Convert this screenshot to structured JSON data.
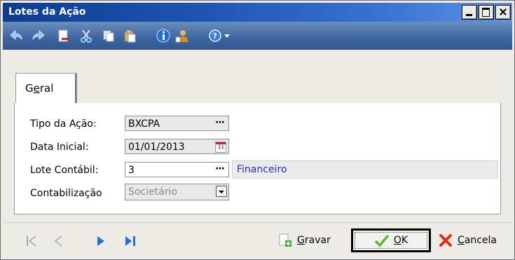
{
  "window": {
    "title": "Lotes da Ação"
  },
  "toolbar": {
    "icons": [
      "undo-icon",
      "redo-icon",
      "new-document-icon",
      "cut-icon",
      "copy-icon",
      "paste-icon",
      "info-icon",
      "user-group-icon",
      "help-icon",
      "dropdown-arrow-icon"
    ]
  },
  "tabs": [
    {
      "label_pre": "G",
      "label_under": "e",
      "label_post": "ral",
      "active": true
    }
  ],
  "form": {
    "tipo": {
      "label": "Tipo da Ação:",
      "value": "BXCPA",
      "button": "···"
    },
    "data": {
      "label": "Data Inicial:",
      "value": "01/01/2013",
      "cal_text": "11"
    },
    "lote": {
      "label": "Lote Contábil:",
      "value": "3",
      "button": "···",
      "description": "Financeiro"
    },
    "contab": {
      "label": "Contabilização",
      "value": "Societário"
    }
  },
  "footer": {
    "gravar": {
      "pre": "",
      "under": "G",
      "post": "ravar"
    },
    "ok": {
      "pre": "",
      "under": "O",
      "post": "K"
    },
    "cancela": {
      "pre": "",
      "under": "C",
      "post": "ancela"
    }
  },
  "colors": {
    "title_bar": "#2055b5",
    "toolbar": "#3d64a0",
    "link_text": "#1f2fb8"
  }
}
